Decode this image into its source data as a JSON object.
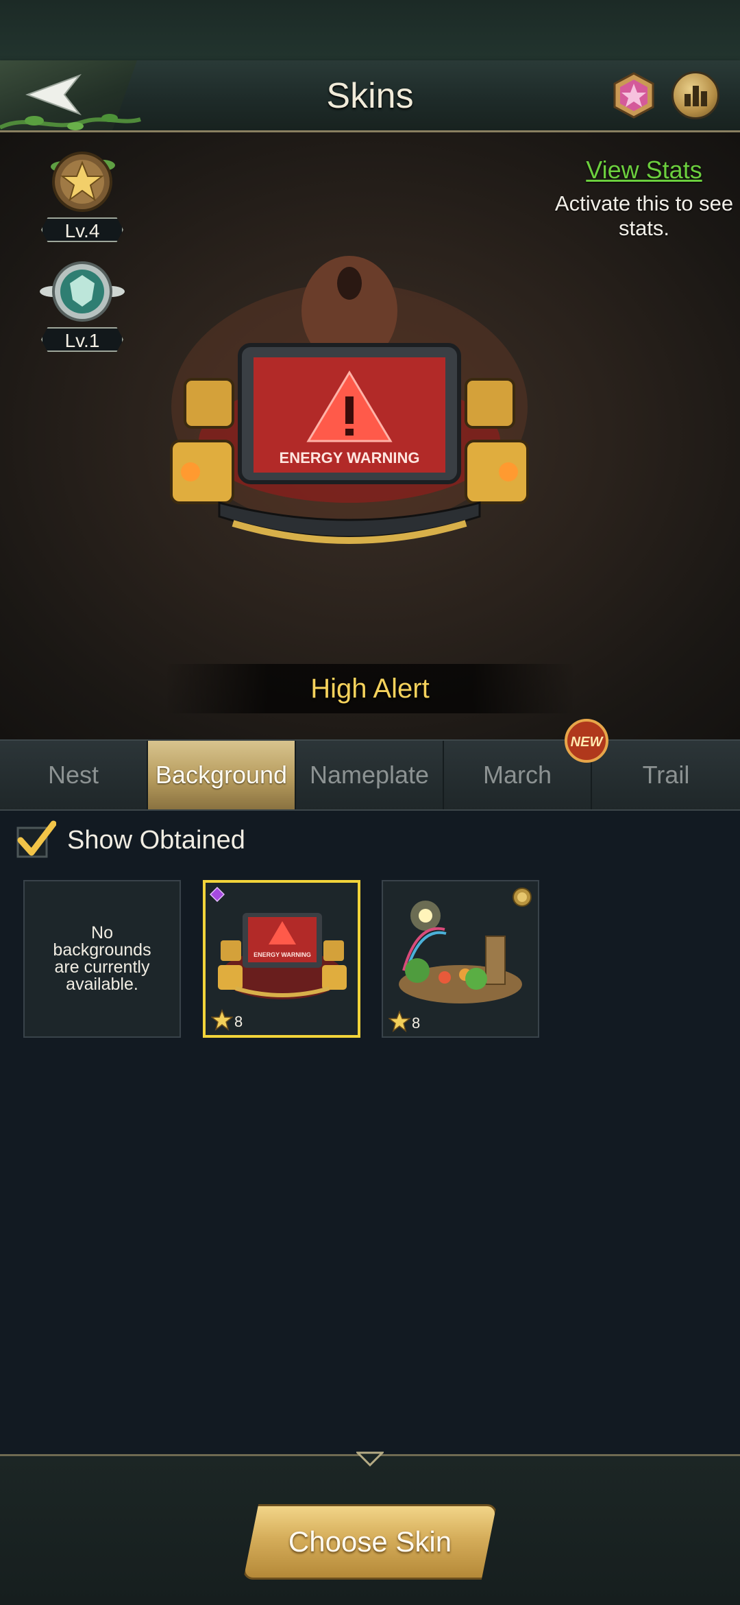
{
  "header": {
    "title": "Skins",
    "back_icon": "back-arrow-icon",
    "gem_icon": "gem-icon",
    "rank_icon": "leaderboard-icon"
  },
  "preview": {
    "nest_badge": {
      "level": "Lv.4",
      "icon": "star-medal-icon"
    },
    "guard_badge": {
      "level": "Lv.1",
      "icon": "shield-emblem-icon"
    },
    "view_stats": "View Stats",
    "stats_hint": "Activate this to see stats.",
    "skin_name": "High Alert",
    "artwork_text": "ENERGY WARNING"
  },
  "tabs": [
    {
      "label": "Nest",
      "active": false
    },
    {
      "label": "Background",
      "active": true
    },
    {
      "label": "Nameplate",
      "active": false
    },
    {
      "label": "March",
      "active": false,
      "badge": "NEW"
    },
    {
      "label": "Trail",
      "active": false
    }
  ],
  "filter": {
    "label": "Show Obtained",
    "checked": true
  },
  "grid": {
    "empty_message": "No backgrounds are currently available.",
    "items": [
      {
        "name": "High Alert",
        "stars": "8",
        "selected": true,
        "corner_icon": "purple-gem-icon",
        "artwork_text": "ENERGY WARNING"
      },
      {
        "name": "garden-background",
        "stars": "8",
        "selected": false,
        "corner_icon": "gold-coin-icon"
      }
    ]
  },
  "footer": {
    "choose_label": "Choose Skin"
  },
  "colors": {
    "accent_gold": "#f2d43a",
    "link_green": "#6ccf3e",
    "skin_name_yellow": "#f5d25c",
    "tab_active": "#c9b276"
  }
}
